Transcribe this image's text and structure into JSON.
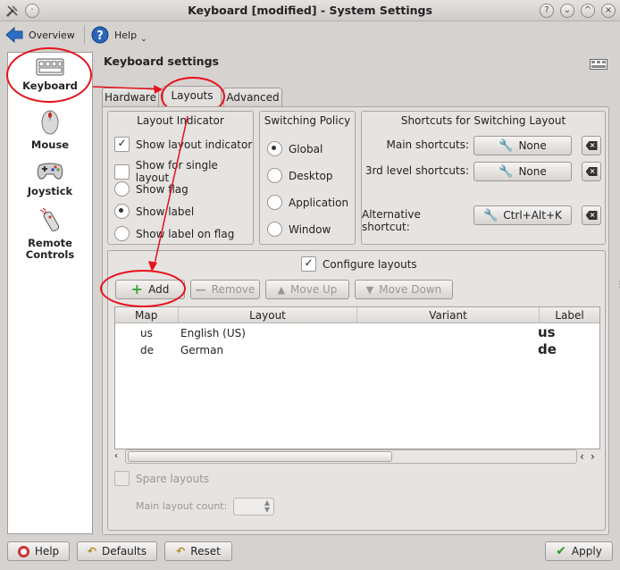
{
  "window": {
    "title": "Keyboard [modified] - System Settings"
  },
  "titlebar_buttons": [
    "?",
    "⌄",
    "^",
    "×"
  ],
  "toolbar": {
    "overview_label": "Overview",
    "help_label": "Help"
  },
  "sidebar": {
    "items": [
      {
        "label": "Keyboard"
      },
      {
        "label": "Mouse"
      },
      {
        "label": "Joystick"
      },
      {
        "label": "Remote Controls"
      }
    ]
  },
  "module": {
    "title": "Keyboard settings"
  },
  "tabs": [
    {
      "label": "Hardware"
    },
    {
      "label": "Layouts"
    },
    {
      "label": "Advanced"
    }
  ],
  "layout_indicator": {
    "title": "Layout Indicator",
    "options": [
      {
        "label": "Show layout indicator",
        "checked": true
      },
      {
        "label": "Show for single layout",
        "checked": false
      }
    ],
    "radios": [
      {
        "label": "Show flag",
        "selected": false
      },
      {
        "label": "Show label",
        "selected": true
      },
      {
        "label": "Show label on flag",
        "selected": false
      }
    ]
  },
  "switching_policy": {
    "title": "Switching Policy",
    "options": [
      {
        "label": "Global",
        "selected": true
      },
      {
        "label": "Desktop",
        "selected": false
      },
      {
        "label": "Application",
        "selected": false
      },
      {
        "label": "Window",
        "selected": false
      }
    ]
  },
  "shortcuts": {
    "title": "Shortcuts for Switching Layout",
    "rows": [
      {
        "label": "Main shortcuts:",
        "value": "None"
      },
      {
        "label": "3rd level shortcuts:",
        "value": "None"
      },
      {
        "label": "Alternative shortcut:",
        "value": "Ctrl+Alt+K"
      }
    ]
  },
  "configure": {
    "label": "Configure layouts",
    "checked": true,
    "add_label": "Add",
    "remove_label": "Remove",
    "move_up_label": "Move Up",
    "move_down_label": "Move Down"
  },
  "table": {
    "headers": {
      "map": "Map",
      "layout": "Layout",
      "variant": "Variant",
      "label": "Label"
    },
    "rows": [
      {
        "map": "us",
        "layout": "English (US)",
        "variant": "",
        "label": "us"
      },
      {
        "map": "de",
        "layout": "German",
        "variant": "",
        "label": "de"
      }
    ]
  },
  "spare": {
    "label": "Spare layouts",
    "count_label": "Main layout count:",
    "checked": false
  },
  "bottom": {
    "help_label": "Help",
    "defaults_label": "Defaults",
    "reset_label": "Reset",
    "apply_label": "Apply"
  },
  "colors": {
    "annotation": "#e8101a",
    "apply_check": "#2f9a2f",
    "add_plus": "#3aa63a"
  }
}
